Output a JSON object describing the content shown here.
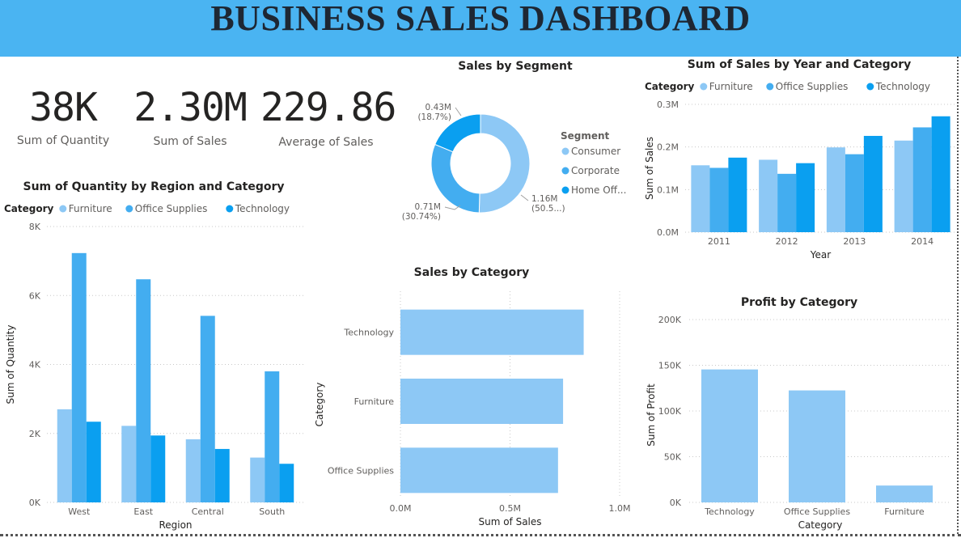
{
  "header": {
    "title": "BUSINESS SALES DASHBOARD"
  },
  "kpis": [
    {
      "value": "38K",
      "label": "Sum of Quantity"
    },
    {
      "value": "2.30M",
      "label": "Sum of Sales"
    },
    {
      "value": "229.86",
      "label": "Average of Sales"
    }
  ],
  "colors": {
    "banner": "#4ab4f2",
    "furniture": "#8dc8f5",
    "office": "#43adf0",
    "technology": "#0a9ff0"
  },
  "chart_data": [
    {
      "id": "qty_region",
      "type": "bar",
      "title": "Sum of Quantity by Region and Category",
      "legend_title": "Category",
      "legend_position": "top-left",
      "xlabel": "Region",
      "ylabel": "Sum of Quantity",
      "ylim": [
        0,
        8000
      ],
      "yticks": [
        "0K",
        "2K",
        "4K",
        "6K",
        "8K"
      ],
      "grid": true,
      "categories": [
        "West",
        "East",
        "Central",
        "South"
      ],
      "series": [
        {
          "name": "Furniture",
          "values": [
            2700,
            2220,
            1830,
            1300
          ]
        },
        {
          "name": "Office Supplies",
          "values": [
            7230,
            6470,
            5410,
            3800
          ]
        },
        {
          "name": "Technology",
          "values": [
            2340,
            1940,
            1550,
            1120
          ]
        }
      ]
    },
    {
      "id": "segment",
      "type": "pie",
      "title": "Sales by Segment",
      "legend_title": "Segment",
      "legend_position": "right",
      "slices": [
        {
          "name": "Consumer",
          "value": 1.16,
          "label": "1.16M",
          "pct": "(50.5...)"
        },
        {
          "name": "Corporate",
          "value": 0.71,
          "label": "0.71M",
          "pct": "(30.74%)"
        },
        {
          "name": "Home Off...",
          "value": 0.43,
          "label": "0.43M",
          "pct": "(18.7%)"
        }
      ]
    },
    {
      "id": "sales_year",
      "type": "bar",
      "title": "Sum of Sales by Year and Category",
      "legend_title": "Category",
      "legend_position": "top-left",
      "xlabel": "Year",
      "ylabel": "Sum of Sales",
      "ylim": [
        0,
        0.3
      ],
      "yticks": [
        "0.0M",
        "0.1M",
        "0.2M",
        "0.3M"
      ],
      "grid": true,
      "categories": [
        "2011",
        "2012",
        "2013",
        "2014"
      ],
      "series": [
        {
          "name": "Furniture",
          "values": [
            0.157,
            0.17,
            0.199,
            0.215
          ]
        },
        {
          "name": "Office Supplies",
          "values": [
            0.151,
            0.137,
            0.183,
            0.246
          ]
        },
        {
          "name": "Technology",
          "values": [
            0.175,
            0.162,
            0.226,
            0.272
          ]
        }
      ]
    },
    {
      "id": "sales_category",
      "type": "bar",
      "orientation": "horizontal",
      "title": "Sales by Category",
      "xlabel": "Sum of Sales",
      "ylabel": "Category",
      "xlim": [
        0,
        1.0
      ],
      "xticks": [
        "0.0M",
        "0.5M",
        "1.0M"
      ],
      "grid": true,
      "categories": [
        "Technology",
        "Furniture",
        "Office Supplies"
      ],
      "values": [
        0.836,
        0.742,
        0.719
      ]
    },
    {
      "id": "profit_category",
      "type": "bar",
      "title": "Profit by Category",
      "xlabel": "Category",
      "ylabel": "Sum of Profit",
      "ylim": [
        0,
        200000
      ],
      "yticks": [
        "0K",
        "50K",
        "100K",
        "150K",
        "200K"
      ],
      "grid": true,
      "categories": [
        "Technology",
        "Office Supplies",
        "Furniture"
      ],
      "values": [
        145455,
        122491,
        18451
      ]
    }
  ]
}
